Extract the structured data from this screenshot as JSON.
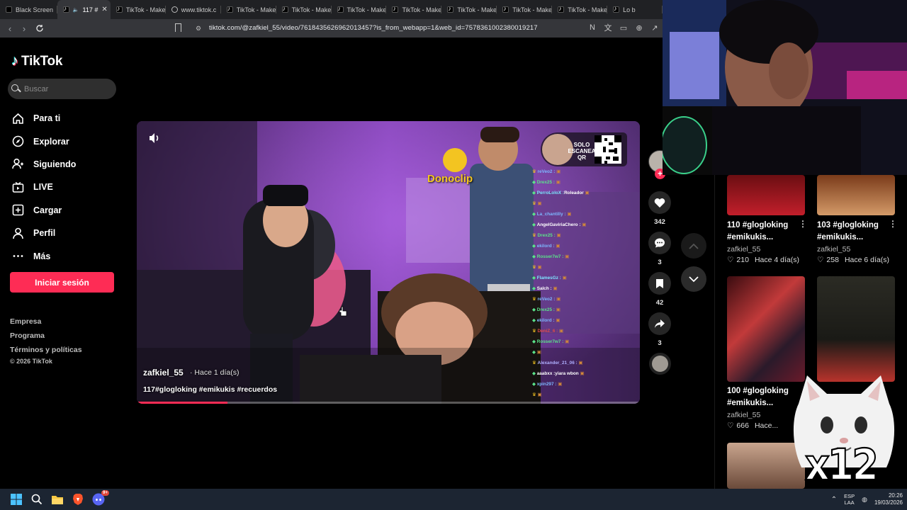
{
  "browser": {
    "tabs": [
      {
        "label": "Black Screen",
        "icon": "black-square-icon"
      },
      {
        "label": "117 #",
        "icon": "tiktok-icon",
        "active": true
      },
      {
        "label": "TikTok - Make",
        "icon": "tiktok-icon"
      },
      {
        "label": "www.tiktok.c",
        "icon": "globe-icon"
      },
      {
        "label": "TikTok - Make",
        "icon": "tiktok-icon"
      },
      {
        "label": "TikTok - Make",
        "icon": "tiktok-icon"
      },
      {
        "label": "TikTok - Make",
        "icon": "tiktok-icon"
      },
      {
        "label": "TikTok - Make",
        "icon": "tiktok-icon"
      },
      {
        "label": "TikTok - Make",
        "icon": "tiktok-icon"
      },
      {
        "label": "TikTok - Make",
        "icon": "tiktok-icon"
      },
      {
        "label": "TikTok - Make",
        "icon": "tiktok-icon"
      },
      {
        "label": "Lo b",
        "icon": "tiktok-icon"
      }
    ],
    "url": "tiktok.com/@zafkiel_55/video/7618435626962013457?is_from_webapp=1&web_id=7578361002380019217"
  },
  "sidebar": {
    "logo": "TikTok",
    "search_placeholder": "Buscar",
    "menu": [
      {
        "label": "Para ti",
        "icon": "home-icon"
      },
      {
        "label": "Explorar",
        "icon": "compass-icon"
      },
      {
        "label": "Siguiendo",
        "icon": "following-icon"
      },
      {
        "label": "LIVE",
        "icon": "live-tv-icon"
      },
      {
        "label": "Cargar",
        "icon": "upload-icon"
      },
      {
        "label": "Perfil",
        "icon": "profile-icon"
      },
      {
        "label": "Más",
        "icon": "more-dots-icon"
      }
    ],
    "login_label": "Iniciar sesión",
    "footer": [
      "Empresa",
      "Programa",
      "Términos y políticas"
    ],
    "copyright": "© 2026 TikTok"
  },
  "video": {
    "author": "zafkiel_55",
    "time": "· Hace 1 día(s)",
    "caption": "117#glogloking #emikukis #recuerdos",
    "progress": 0.18,
    "overlay_brand": "Donoclip",
    "promo_text": "SOLO ESCANEA QR",
    "chat": [
      {
        "user": "reVeo2 :",
        "text": "",
        "color": "#7db7ff"
      },
      {
        "user": "Drex25 :",
        "text": "",
        "color": "#5be38a"
      },
      {
        "user": "PerroLoloX :",
        "text": "Roleador",
        "color": "#7ee4ff"
      },
      {
        "user": "",
        "text": "",
        "color": "#e04a4a"
      },
      {
        "user": "La_chantilly :",
        "text": "",
        "color": "#7db7ff"
      },
      {
        "user": "AngelGaviriaChero :",
        "text": "",
        "color": "#ffffff"
      },
      {
        "user": "Drex25 :",
        "text": "",
        "color": "#5be38a"
      },
      {
        "user": "ekilord :",
        "text": "",
        "color": "#7db7ff"
      },
      {
        "user": "Rosser7w7 :",
        "text": "",
        "color": "#5be38a"
      },
      {
        "user": "",
        "text": "",
        "color": "#e04a4a"
      },
      {
        "user": "FlamesGz :",
        "text": "",
        "color": "#7ee4ff"
      },
      {
        "user": "Salch :",
        "text": "",
        "color": "#ffffff"
      },
      {
        "user": "reVeo2 :",
        "text": "",
        "color": "#7db7ff"
      },
      {
        "user": "Drex25 :",
        "text": "",
        "color": "#5be38a"
      },
      {
        "user": "ekilord :",
        "text": "",
        "color": "#7db7ff"
      },
      {
        "user": "DeniZ_6 :",
        "text": "",
        "color": "#e04a4a"
      },
      {
        "user": "Rosser7w7 :",
        "text": "",
        "color": "#5be38a"
      },
      {
        "user": "",
        "text": "",
        "color": "#e04a4a"
      },
      {
        "user": "Alexander_21_06 :",
        "text": "",
        "color": "#b0b0ff"
      },
      {
        "user": "aaabxx :",
        "text": "yiara wbon",
        "color": "#ffffff"
      },
      {
        "user": "xpin297 :",
        "text": "",
        "color": "#7db7ff"
      },
      {
        "user": "",
        "text": "",
        "color": "#e04a4a"
      }
    ]
  },
  "actions": {
    "likes": "342",
    "comments": "3",
    "saves": "42",
    "shares": "3"
  },
  "related": [
    {
      "title": "110 #glogloking #emikukis...",
      "user": "zafkiel_55",
      "views": "210",
      "time": "Hace 4 día(s)"
    },
    {
      "title": "103 #glogloking #emikukis...",
      "user": "zafkiel_55",
      "views": "258",
      "time": "Hace 6 día(s)"
    },
    {
      "title": "100 #glogloking #emikukis...",
      "user": "zafkiel_55",
      "views": "666",
      "time": "Hace..."
    }
  ],
  "overlay": {
    "multiplier": "x12"
  },
  "taskbar": {
    "lang_top": "ESP",
    "lang_bottom": "LAA",
    "time": "20:26",
    "date": "19/03/2026",
    "discord_badge": "9+"
  },
  "colors": {
    "accent": "#fe2c55",
    "sidebar_bg": "#000000",
    "chrome_bg": "#35363a"
  }
}
